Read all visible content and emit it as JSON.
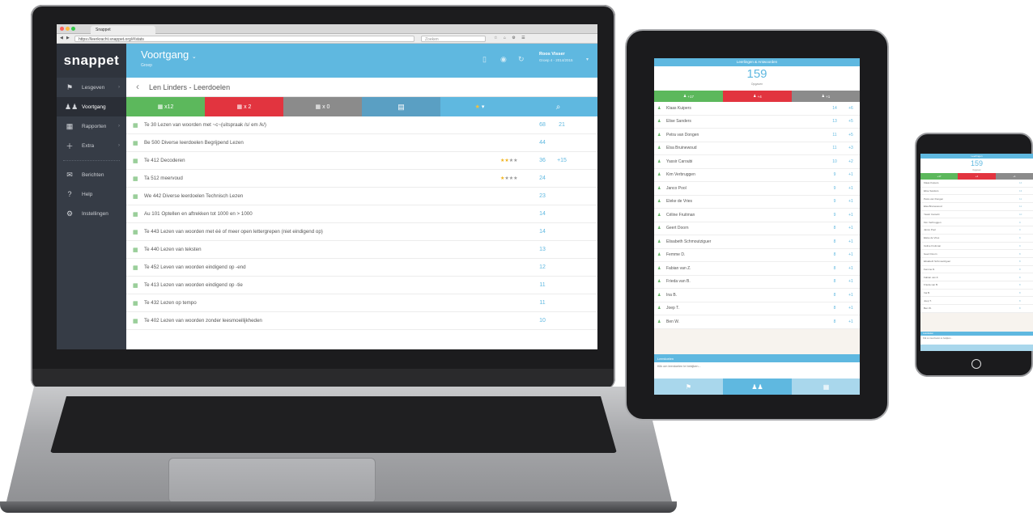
{
  "browser": {
    "tab_title": "Snappet",
    "url": "https://leerkracht.snappet.org/#/stats",
    "search_placeholder": "Zoeken"
  },
  "sidebar": {
    "brand": "snappet",
    "items": [
      {
        "label": "Lesgeven",
        "icon": "presenter-icon"
      },
      {
        "label": "Voortgang",
        "icon": "people-icon"
      },
      {
        "label": "Rapporten",
        "icon": "grid-icon"
      },
      {
        "label": "Extra",
        "icon": "plus-icon"
      },
      {
        "label": "Berichten",
        "icon": "mail-icon"
      },
      {
        "label": "Help",
        "icon": "help-icon"
      },
      {
        "label": "Instellingen",
        "icon": "gear-icon"
      }
    ]
  },
  "header": {
    "title": "Voortgang",
    "subtitle": "Groep",
    "user_name": "Roos Visser",
    "user_sub": "Groep 4 - 2014/2015"
  },
  "subheader": {
    "back_icon": "chevron-left-icon",
    "title": "Len Linders - Leerdoelen"
  },
  "filters": [
    {
      "label": "x12",
      "color": "#5cb85c"
    },
    {
      "label": "x 2",
      "color": "#e2343f"
    },
    {
      "label": "x 0",
      "color": "#8b8b8b"
    },
    {
      "label": "",
      "color": "#5a9fc3"
    },
    {
      "label": "",
      "color": "#5fb8e0"
    },
    {
      "label": "",
      "color": "#5fb8e0"
    }
  ],
  "goals": [
    {
      "text": "Te 30 Lezen van woorden met ~c~(uitspraak /s/ em /k/)",
      "stars": "",
      "v1": "68",
      "v2": "21"
    },
    {
      "text": "Be 500 Diverse leerdoelen Begrijpend Lezen",
      "stars": "",
      "v1": "44",
      "v2": ""
    },
    {
      "text": "Te 412 Decoderen",
      "stars": "★★★★",
      "gold": 2,
      "v1": "36",
      "v2": "+15"
    },
    {
      "text": "Ta 512 meervoud",
      "stars": "★★★★",
      "gold": 1,
      "v1": "24",
      "v2": ""
    },
    {
      "text": "We 442 Diverse leerdoelen Technisch Lezen",
      "stars": "",
      "v1": "23",
      "v2": ""
    },
    {
      "text": "Au 101 Optellen en aftrekken tot 1000 en > 1000",
      "stars": "",
      "v1": "14",
      "v2": ""
    },
    {
      "text": "Te 443 Lezen van woorden met éé of meer open lettergrepen (niet eindigend op)",
      "stars": "",
      "v1": "14",
      "v2": ""
    },
    {
      "text": "Te 440 Lezen van teksten",
      "stars": "",
      "v1": "13",
      "v2": ""
    },
    {
      "text": "Te 452 Leven van woorden eindigend op -end",
      "stars": "",
      "v1": "12",
      "v2": ""
    },
    {
      "text": "Te 413 Lezen van woorden eindigend op -tie",
      "stars": "",
      "v1": "11",
      "v2": ""
    },
    {
      "text": "Te 432 Lezen op tempo",
      "stars": "",
      "v1": "11",
      "v2": ""
    },
    {
      "text": "Te 402 Lezen van woorden zonder leesmoeilijkheden",
      "stars": "",
      "v1": "10",
      "v2": ""
    }
  ],
  "tablet": {
    "header": "Leerlingen & Antwoorden",
    "count": "159",
    "count_label": "Opgaven",
    "tabs": [
      {
        "label": "+17",
        "color": "#5cb85c"
      },
      {
        "label": "+4",
        "color": "#e2343f"
      },
      {
        "label": "+1",
        "color": "#8b8b8b"
      }
    ],
    "students": [
      {
        "name": "Klaas Kuipers",
        "a": "14",
        "b": "+6"
      },
      {
        "name": "Elise Sanders",
        "a": "13",
        "b": "+5"
      },
      {
        "name": "Petra van Dongen",
        "a": "11",
        "b": "+5"
      },
      {
        "name": "Elsa Bruinewoud",
        "a": "11",
        "b": "+3"
      },
      {
        "name": "Yassir Caroubi",
        "a": "10",
        "b": "+2"
      },
      {
        "name": "Kim Verbruggen",
        "a": "9",
        "b": "+1"
      },
      {
        "name": "Janco Pool",
        "a": "9",
        "b": "+1"
      },
      {
        "name": "Eleke de Vries",
        "a": "9",
        "b": "+1"
      },
      {
        "name": "Céline Fruitman",
        "a": "9",
        "b": "+1"
      },
      {
        "name": "Geert Doorn",
        "a": "8",
        "b": "+1"
      },
      {
        "name": "Elisabeth Schmoutziguer",
        "a": "8",
        "b": "+1"
      },
      {
        "name": "Femme D.",
        "a": "8",
        "b": "+1"
      },
      {
        "name": "Fabian van Z.",
        "a": "8",
        "b": "+1"
      },
      {
        "name": "Frieda van B.",
        "a": "8",
        "b": "+1"
      },
      {
        "name": "Ina B.",
        "a": "8",
        "b": "+1"
      },
      {
        "name": "Joep T.",
        "a": "8",
        "b": "+1"
      },
      {
        "name": "Ben W.",
        "a": "8",
        "b": "+1"
      }
    ],
    "footer_title": "Leerdoelen",
    "footer_text": "Klik om leerdoelen te bekijken..."
  },
  "phone": {
    "header": "Leerlingen",
    "count": "159",
    "count_label": "Opgaven",
    "tabs": [
      "+17",
      "+4",
      "+1"
    ],
    "students": [
      {
        "name": "Klaas Kuipers",
        "a": "14"
      },
      {
        "name": "Elise Sanders",
        "a": "13"
      },
      {
        "name": "Petra van Dongen",
        "a": "11"
      },
      {
        "name": "Elsa Bruinewoud",
        "a": "11"
      },
      {
        "name": "Yassir Caroubi",
        "a": "10"
      },
      {
        "name": "Kim Verbruggen",
        "a": "9"
      },
      {
        "name": "Janco Pool",
        "a": "9"
      },
      {
        "name": "Eleke de Vries",
        "a": "9"
      },
      {
        "name": "Céline Fruitman",
        "a": "9"
      },
      {
        "name": "Geert Doorn",
        "a": "8"
      },
      {
        "name": "Elisabeth Schmoutziguer",
        "a": "8"
      },
      {
        "name": "Femme D.",
        "a": "8"
      },
      {
        "name": "Fabian van Z.",
        "a": "8"
      },
      {
        "name": "Frieda van B.",
        "a": "8"
      },
      {
        "name": "Ina B.",
        "a": "8"
      },
      {
        "name": "Joep T.",
        "a": "8"
      },
      {
        "name": "Ben W.",
        "a": "8"
      }
    ],
    "footer_title": "Leerdoelen",
    "footer_text": "Klik om leerdoelen te bekijken..."
  }
}
